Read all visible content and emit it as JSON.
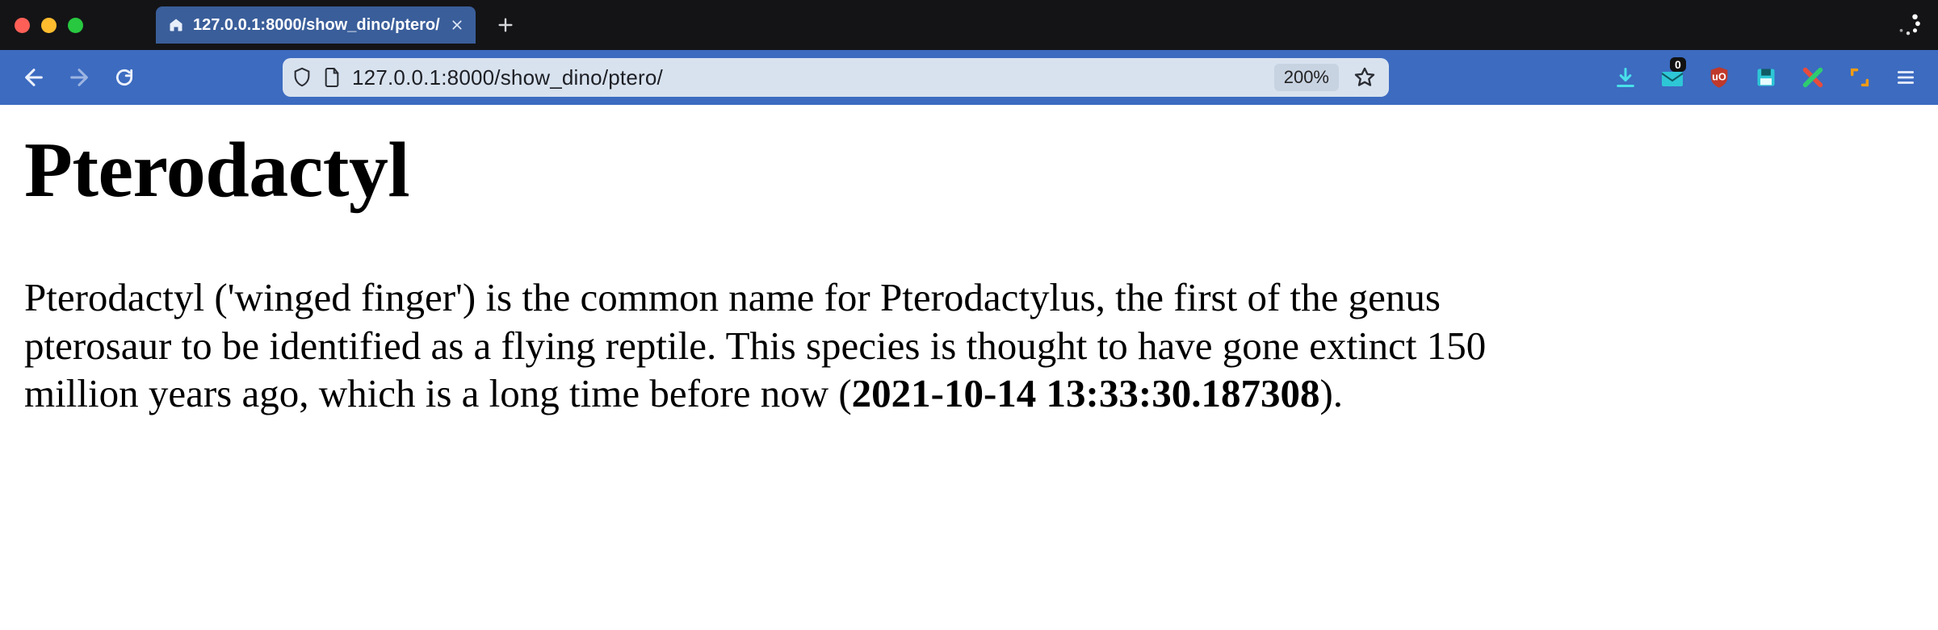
{
  "tabstrip": {
    "tab_title": "127.0.0.1:8000/show_dino/ptero/"
  },
  "toolbar": {
    "url": "127.0.0.1:8000/show_dino/ptero/",
    "zoom_label": "200%",
    "mail_badge": "0"
  },
  "content": {
    "heading": "Pterodactyl",
    "paragraph_pre": "Pterodactyl ('winged finger') is the common name for Pterodactylus, the first of the genus pterosaur to be identified as a flying reptile. This species is thought to have gone extinct 150 million years ago, which is a long time before now (",
    "timestamp": "2021-10-14 13:33:30.187308",
    "paragraph_post": ")."
  }
}
